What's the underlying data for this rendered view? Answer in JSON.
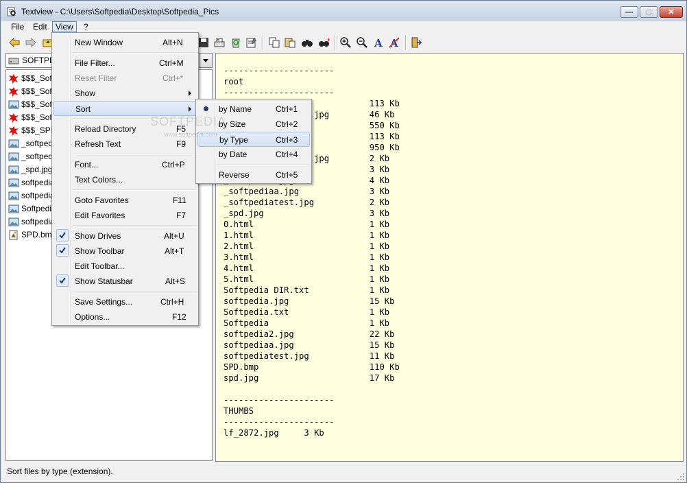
{
  "window": {
    "title": "Textview - C:\\Users\\Softpedia\\Desktop\\Softpedia_Pics",
    "min_glyph": "—",
    "max_glyph": "□",
    "close_glyph": "✕"
  },
  "menubar": {
    "items": [
      {
        "label": "File"
      },
      {
        "label": "Edit"
      },
      {
        "label": "View"
      },
      {
        "label": "?"
      }
    ]
  },
  "toolbar": {
    "icons": [
      "back-icon",
      "forward-icon",
      "up-folder-icon",
      "save-icon",
      "print-icon",
      "recycle-icon",
      "properties-icon",
      "copy-icon",
      "paste-icon",
      "find-icon",
      "find-next-icon",
      "zoom-in-icon",
      "zoom-out-icon",
      "font-icon",
      "text-color-icon",
      "exit-icon"
    ]
  },
  "drive": {
    "label": "SOFTPEDIA"
  },
  "files": [
    {
      "name": "$$$_Softpedia.jpg",
      "type": "red"
    },
    {
      "name": "$$$_Softpedia.png",
      "type": "red"
    },
    {
      "name": "$$$_Softpedia2.jpg",
      "type": "img"
    },
    {
      "name": "$$$_Softpediatest.jpg",
      "type": "red"
    },
    {
      "name": "$$$_SPD.bmp",
      "type": "red"
    },
    {
      "name": "_softpedia.jpg",
      "type": "img"
    },
    {
      "name": "_softpediaa.jpg",
      "type": "img"
    },
    {
      "name": "_spd.jpg",
      "type": "img"
    },
    {
      "name": "softpedia2.jpg",
      "type": "img"
    },
    {
      "name": "softpediaa.jpg",
      "type": "img"
    },
    {
      "name": "Softpedia",
      "type": "img"
    },
    {
      "name": "softpediatest.jpg",
      "type": "img"
    },
    {
      "name": "SPD.bmp",
      "type": "bmp"
    }
  ],
  "text_lines": [
    "----------------------",
    "root",
    "----------------------",
    "$$$_Softpedia.jpg            113 Kb",
    "$$$_Softpediatest.jpg        46 Kb",
    "$$$_Softpedia.png            550 Kb",
    "$$$_Softpedia.png            113 Kb",
    "$$$_SPD.bmp                  950 Kb",
    "$$$_Softpediatest.jpg        2 Kb",
    "_softpedia.jpg               3 Kb",
    "_softpedia.jpg               4 Kb",
    "_softpediaa.jpg              3 Kb",
    "_softpediatest.jpg           2 Kb",
    "_spd.jpg                     3 Kb",
    "0.html                       1 Kb",
    "1.html                       1 Kb",
    "2.html                       1 Kb",
    "3.html                       1 Kb",
    "4.html                       1 Kb",
    "5.html                       1 Kb",
    "Softpedia DIR.txt            1 Kb",
    "softpedia.jpg                15 Kb",
    "Softpedia.txt                1 Kb",
    "Softpedia                    1 Kb",
    "softpedia2.jpg               22 Kb",
    "softpediaa.jpg               15 Kb",
    "softpediatest.jpg            11 Kb",
    "SPD.bmp                      110 Kb",
    "spd.jpg                      17 Kb",
    "",
    "----------------------",
    "THUMBS",
    "----------------------",
    "lf_2872.jpg     3 Kb"
  ],
  "view_menu": [
    {
      "label": "New Window",
      "accel": "Alt+N"
    },
    {
      "label": "File Filter...",
      "accel": "Ctrl+M"
    },
    {
      "label": "Reset Filter",
      "accel": "Ctrl+*"
    },
    {
      "label": "Show",
      "accel": ""
    },
    {
      "label": "Sort",
      "accel": ""
    },
    {
      "label": "Reload Directory",
      "accel": "F5"
    },
    {
      "label": "Refresh Text",
      "accel": "F9"
    },
    {
      "label": "Font...",
      "accel": "Ctrl+P"
    },
    {
      "label": "Text Colors...",
      "accel": ""
    },
    {
      "label": "Goto Favorites",
      "accel": "F11"
    },
    {
      "label": "Edit Favorites",
      "accel": "F7"
    },
    {
      "label": "Show Drives",
      "accel": "Alt+U"
    },
    {
      "label": "Show Toolbar",
      "accel": "Alt+T"
    },
    {
      "label": "Edit Toolbar...",
      "accel": ""
    },
    {
      "label": "Show Statusbar",
      "accel": "Alt+S"
    },
    {
      "label": "Save Settings...",
      "accel": "Ctrl+H"
    },
    {
      "label": "Options...",
      "accel": "F12"
    }
  ],
  "sort_menu": [
    {
      "label": "by Name",
      "accel": "Ctrl+1"
    },
    {
      "label": "by Size",
      "accel": "Ctrl+2"
    },
    {
      "label": "by Type",
      "accel": "Ctrl+3"
    },
    {
      "label": "by Date",
      "accel": "Ctrl+4"
    },
    {
      "label": "Reverse",
      "accel": "Ctrl+5"
    }
  ],
  "watermark": {
    "text": "SOFTPEDIA",
    "sub": "www.softpedia.com"
  },
  "statusbar": {
    "text": "Sort files by type (extension)."
  },
  "colors": {
    "text_bg": "#ffffe0",
    "menu_highlight": "#d2dff3",
    "accent": "#1f3b73"
  }
}
